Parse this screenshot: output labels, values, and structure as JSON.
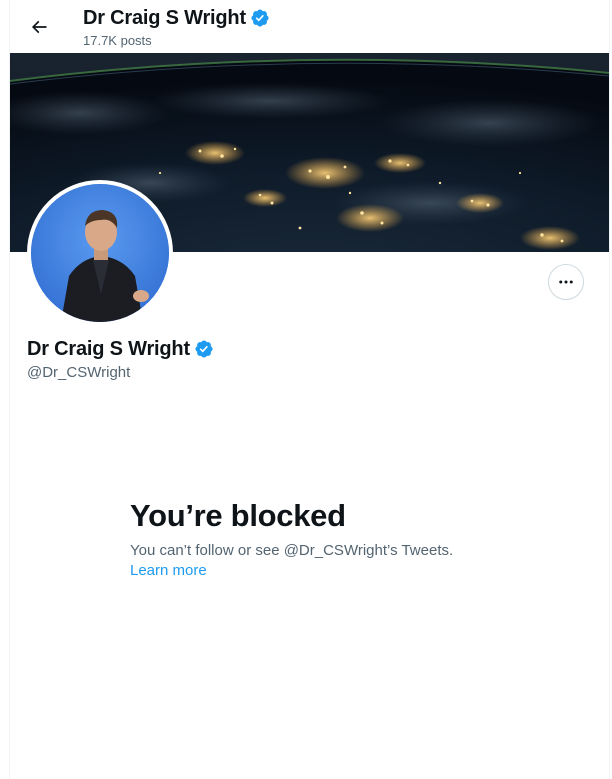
{
  "header": {
    "back_icon": "arrow-left-icon",
    "name": "Dr Craig S Wright",
    "posts_count": "17.7K posts"
  },
  "profile": {
    "name": "Dr Craig S Wright",
    "handle": "@Dr_CSWright",
    "verified": true,
    "more_icon": "more-horizontal-icon"
  },
  "blocked": {
    "title": "You’re blocked",
    "message": "You can’t follow or see @Dr_CSWright’s Tweets.",
    "link_label": "Learn more"
  },
  "colors": {
    "verified_badge": "#1d9bf0",
    "link": "#1d9bf0",
    "secondary_text": "#536471"
  }
}
